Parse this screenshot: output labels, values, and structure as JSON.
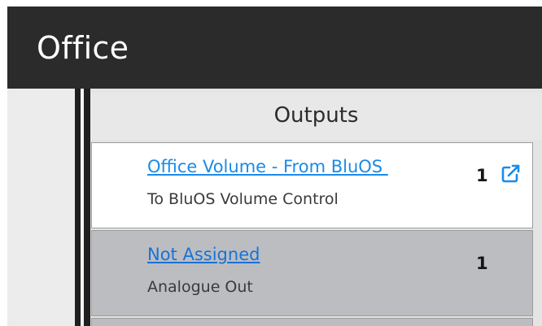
{
  "window": {
    "title": "Office"
  },
  "outputs": {
    "header": "Outputs",
    "rows": [
      {
        "name": "Office Volume - From BluOS ",
        "subtitle": "To BluOS Volume Control",
        "count": "1",
        "has_open_icon": true
      },
      {
        "name": "Not Assigned",
        "subtitle": "Analogue Out",
        "count": "1",
        "has_open_icon": false
      }
    ]
  },
  "icons": {
    "open_in_new": "external-link-icon"
  },
  "colors": {
    "title_bar": "#2b2b2b",
    "link": "#1a8be8",
    "row_selected_bg": "#ffffff",
    "row_bg": "#bcbdc1",
    "panel_bg": "#e4e4e4"
  }
}
